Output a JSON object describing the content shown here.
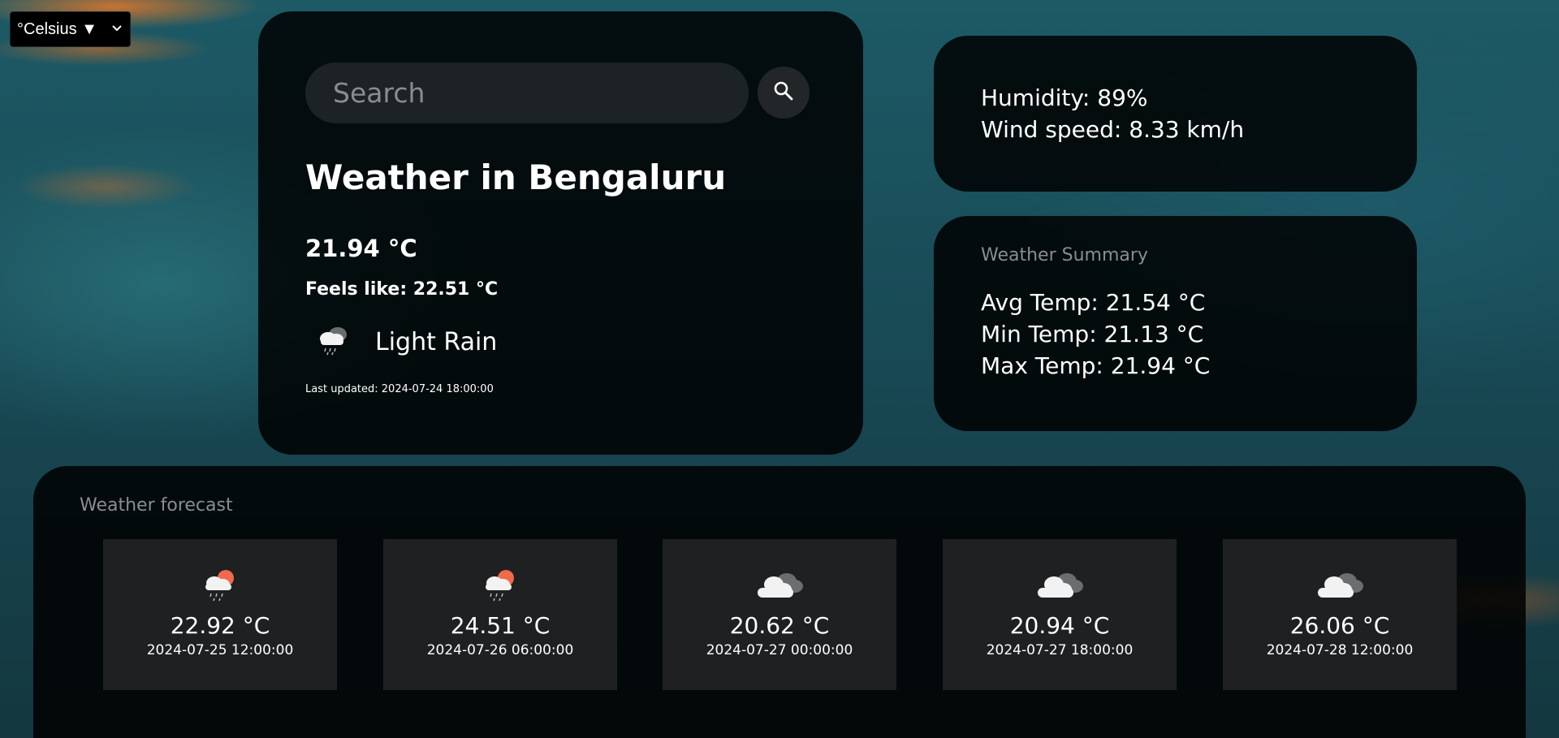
{
  "unit_select": {
    "value": "°Celsius ▼"
  },
  "search": {
    "placeholder": "Search"
  },
  "current": {
    "title": "Weather in Bengaluru",
    "temp": "21.94 °C",
    "feels_like": "Feels like: 22.51 °C",
    "description": "Light Rain",
    "icon": "rain-cloud-icon",
    "last_updated": "Last updated: 2024-07-24 18:00:00"
  },
  "details": {
    "humidity": "Humidity: 89%",
    "wind": "Wind speed: 8.33 km/h"
  },
  "summary": {
    "title": "Weather Summary",
    "avg": "Avg Temp: 21.54 °C",
    "min": "Min Temp: 21.13 °C",
    "max": "Max Temp: 21.94 °C"
  },
  "forecast": {
    "title": "Weather forecast",
    "items": [
      {
        "temp": "22.92 °C",
        "date": "2024-07-25 12:00:00",
        "icon": "sun-rain-cloud-icon"
      },
      {
        "temp": "24.51 °C",
        "date": "2024-07-26 06:00:00",
        "icon": "sun-rain-cloud-icon"
      },
      {
        "temp": "20.62 °C",
        "date": "2024-07-27 00:00:00",
        "icon": "cloud-icon"
      },
      {
        "temp": "20.94 °C",
        "date": "2024-07-27 18:00:00",
        "icon": "cloud-icon"
      },
      {
        "temp": "26.06 °C",
        "date": "2024-07-28 12:00:00",
        "icon": "cloud-icon"
      }
    ]
  },
  "colors": {
    "panel_bg": "#000000",
    "muted_text": "#8a8d8f",
    "sun": "#f26a4b"
  }
}
